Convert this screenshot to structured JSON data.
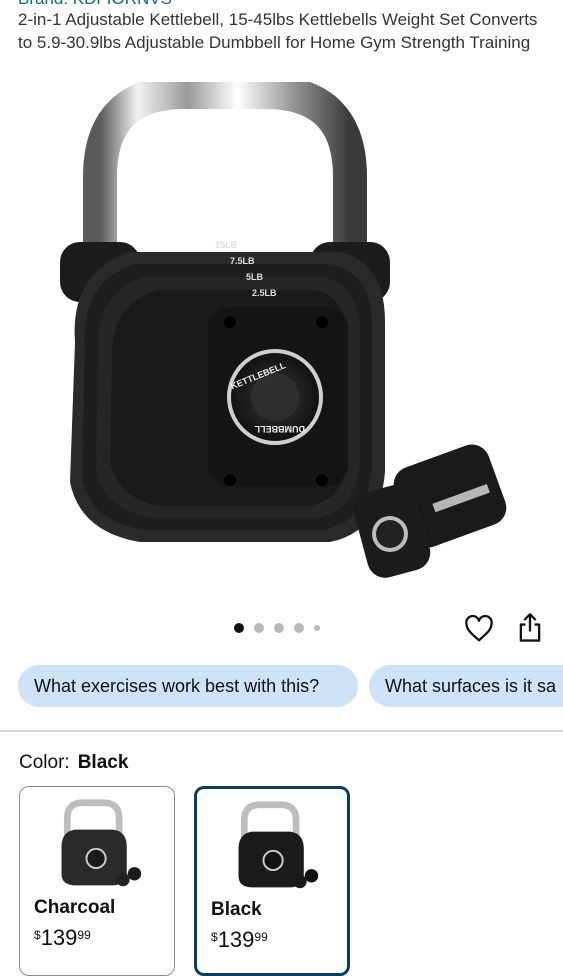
{
  "product": {
    "brand_line": "Brand: KDFIORNVS",
    "title": "2-in-1 Adjustable Kettlebell, 15-45lbs Kettlebells Weight Set Converts to 5.9-30.9lbs Adjustable Dumbbell for Home Gym Strength Training",
    "image": {
      "plate_labels": [
        "15LB",
        "7.5LB",
        "5LB",
        "2.5LB"
      ],
      "dial_top": "KETTLEBELL",
      "dial_bottom": "DUMBBELL"
    },
    "carousel": {
      "count": 5,
      "active_index": 0
    }
  },
  "actions": {
    "heart_icon": "heart-outline-icon",
    "share_icon": "share-icon"
  },
  "questions": [
    {
      "label": "What exercises work best with this?"
    },
    {
      "label": "What surfaces is it sa"
    }
  ],
  "color_selector": {
    "label": "Color:",
    "selected": "Black",
    "options": [
      {
        "name": "Charcoal",
        "currency": "$",
        "price_whole": "139",
        "price_fraction": "99",
        "selected": false
      },
      {
        "name": "Black",
        "currency": "$",
        "price_whole": "139",
        "price_fraction": "99",
        "selected": true
      }
    ]
  },
  "colors": {
    "link": "#007185",
    "chip_bg": "#cfe3f8",
    "selected_border": "#0a3d62"
  }
}
